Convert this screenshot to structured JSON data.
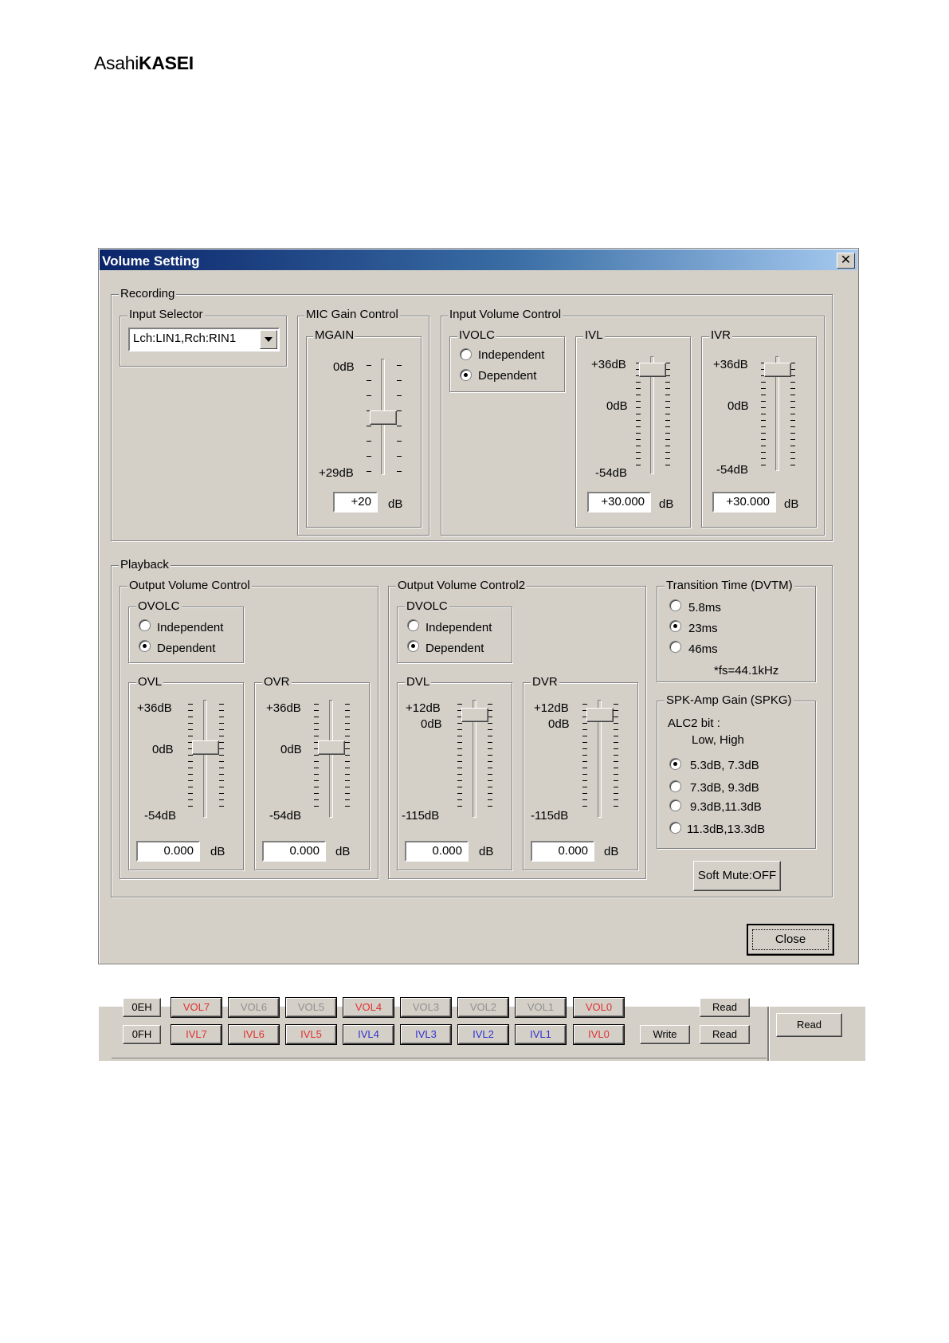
{
  "logo": {
    "part1": "Asahi",
    "part2": "KASEI"
  },
  "dialog": {
    "title": "Volume Setting",
    "close_x": "✕",
    "close_button": "Close",
    "db_unit": "dB"
  },
  "recording": {
    "label": "Recording",
    "input_selector": {
      "label": "Input Selector",
      "value": "Lch:LIN1,Rch:RIN1"
    },
    "mic_gain": {
      "group_label": "MIC Gain Control",
      "slider_label": "MGAIN",
      "top": "0dB",
      "bottom": "+29dB",
      "value": "+20"
    },
    "input_volume": {
      "label": "Input Volume Control",
      "ivolc": {
        "label": "IVOLC",
        "opt_independent": "Independent",
        "opt_dependent": "Dependent",
        "selected": "Dependent"
      },
      "ivl": {
        "label": "IVL",
        "top": "+36dB",
        "mid": "0dB",
        "bottom": "-54dB",
        "value": "+30.000"
      },
      "ivr": {
        "label": "IVR",
        "top": "+36dB",
        "mid": "0dB",
        "bottom": "-54dB",
        "value": "+30.000"
      }
    }
  },
  "playback": {
    "label": "Playback",
    "output_volume": {
      "label": "Output Volume Control",
      "ovolc": {
        "label": "OVOLC",
        "opt_independent": "Independent",
        "opt_dependent": "Dependent",
        "selected": "Dependent"
      },
      "ovl": {
        "label": "OVL",
        "top": "+36dB",
        "mid": "0dB",
        "bottom": "-54dB",
        "value": "0.000"
      },
      "ovr": {
        "label": "OVR",
        "top": "+36dB",
        "mid": "0dB",
        "bottom": "-54dB",
        "value": "0.000"
      }
    },
    "output_volume2": {
      "label": "Output Volume Control2",
      "dvolc": {
        "label": "DVOLC",
        "opt_independent": "Independent",
        "opt_dependent": "Dependent",
        "selected": "Dependent"
      },
      "dvl": {
        "label": "DVL",
        "top": "+12dB",
        "mid": "0dB",
        "bottom": "-115dB",
        "value": "0.000"
      },
      "dvr": {
        "label": "DVR",
        "top": "+12dB",
        "mid": "0dB",
        "bottom": "-115dB",
        "value": "0.000"
      }
    },
    "transition_time": {
      "label": "Transition Time (DVTM)",
      "options": [
        "5.8ms",
        "23ms",
        "46ms"
      ],
      "selected": "23ms",
      "note": "*fs=44.1kHz"
    },
    "spk_amp_gain": {
      "label": "SPK-Amp Gain (SPKG)",
      "alc_line1": "ALC2 bit :",
      "alc_line2": "Low, High",
      "options": [
        "5.3dB, 7.3dB",
        "7.3dB, 9.3dB",
        "9.3dB,11.3dB",
        "11.3dB,13.3dB"
      ],
      "selected": "5.3dB, 7.3dB"
    },
    "soft_mute": "Soft Mute:OFF"
  },
  "register_strip": {
    "row_0E": {
      "addr": "0EH",
      "bits": [
        "VOL7",
        "VOL6",
        "VOL5",
        "VOL4",
        "VOL3",
        "VOL2",
        "VOL1",
        "VOL0"
      ],
      "read": "Read"
    },
    "row_0F": {
      "addr": "0FH",
      "bits": [
        "IVL7",
        "IVL6",
        "IVL5",
        "IVL4",
        "IVL3",
        "IVL2",
        "IVL1",
        "IVL0"
      ],
      "write": "Write",
      "read": "Read"
    },
    "side_read": "Read",
    "colors": {
      "set": "#e03030",
      "clear": "#3030d0",
      "dim": "#909090"
    }
  }
}
